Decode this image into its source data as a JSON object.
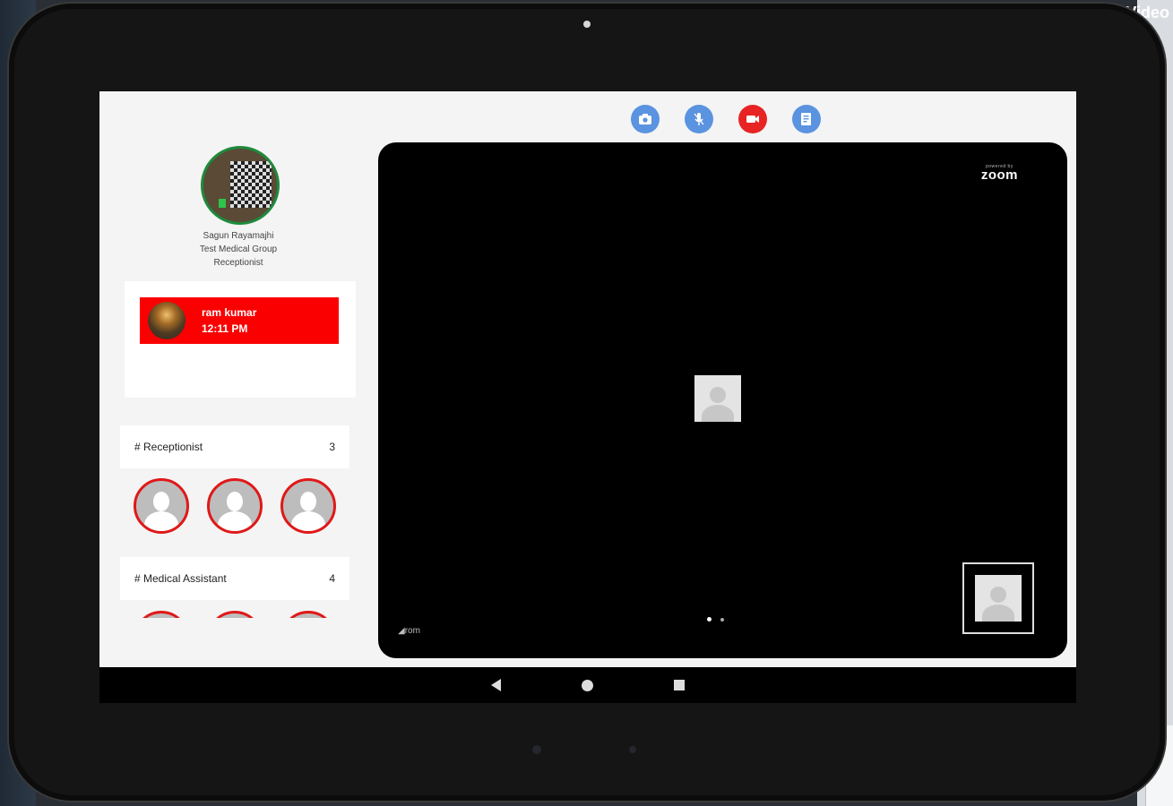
{
  "background": {
    "window_label": "Video"
  },
  "profile": {
    "name": "Sagun Rayamajhi",
    "organization": "Test Medical Group",
    "role": "Receptionist",
    "status_color": "#1e8a3c"
  },
  "queue": {
    "items": [
      {
        "name": "ram kumar",
        "time": "12:11 PM"
      }
    ],
    "item_color": "#fb0000"
  },
  "groups": [
    {
      "title": "# Receptionist",
      "count": "3",
      "members_visible": 3
    },
    {
      "title": "# Medical Assistant",
      "count": "4",
      "members_visible": 3
    }
  ],
  "call_actions": [
    {
      "icon": "camera-switch-icon",
      "color": "#5a93e0"
    },
    {
      "icon": "microphone-icon",
      "color": "#5a93e0"
    },
    {
      "icon": "video-toggle-icon",
      "color": "#e82323"
    },
    {
      "icon": "chat-icon",
      "color": "#5a93e0"
    }
  ],
  "video": {
    "brand_small": "powered by",
    "brand": "zoom",
    "participant_label": "rom",
    "page_count": 2,
    "current_page": 1
  },
  "navbar": {
    "buttons": [
      "back",
      "home",
      "recents"
    ]
  }
}
